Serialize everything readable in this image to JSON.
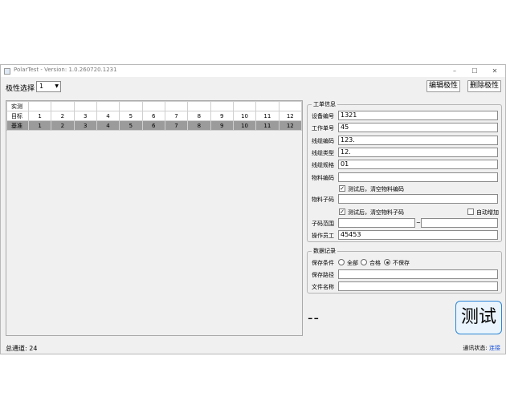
{
  "window": {
    "title": "PolarTest - Version: 1.0.260720.1231",
    "min": "–",
    "max": "☐",
    "close": "✕"
  },
  "toolbar": {
    "polarity_label": "极性选择",
    "polarity_value": "1",
    "edit_button": "编辑极性",
    "delete_button": "删除极性"
  },
  "grid": {
    "rows": [
      {
        "label": "实测",
        "cells": [
          "",
          "",
          "",
          "",
          "",
          "",
          "",
          "",
          "",
          "",
          "",
          ""
        ]
      },
      {
        "label": "目标",
        "cells": [
          "1",
          "2",
          "3",
          "4",
          "5",
          "6",
          "7",
          "8",
          "9",
          "10",
          "11",
          "12"
        ]
      },
      {
        "label": "基准",
        "cells": [
          "1",
          "2",
          "3",
          "4",
          "5",
          "6",
          "7",
          "8",
          "9",
          "10",
          "11",
          "12"
        ]
      }
    ]
  },
  "work_order": {
    "title": "工单信息",
    "device_no_label": "设备编号",
    "device_no": "1321",
    "order_no_label": "工作单号",
    "order_no": "45",
    "cable_code_label": "线缆编码",
    "cable_code": "123.",
    "cable_type_label": "线缆类型",
    "cable_type": "12.",
    "cable_spec_label": "线缆规格",
    "cable_spec": "01",
    "material_code_label": "物料编码",
    "material_code": "",
    "clear_material_label": "测试后，清空物料编码",
    "material_sub_label": "物料子码",
    "material_sub": "",
    "clear_sub_label": "测试后，清空物料子码",
    "auto_increase_label": "自动增加",
    "sub_range_label": "子码范围",
    "range_sep": "~",
    "range_from": "",
    "range_to": "",
    "operator_label": "操作员工",
    "operator": "45453"
  },
  "data_record": {
    "title": "数据记录",
    "save_cond_label": "保存条件",
    "opt_all": "全部",
    "opt_pass": "合格",
    "opt_nosave": "不保存",
    "save_path_label": "保存路径",
    "save_path": "",
    "file_name_label": "文件名称",
    "file_name": ""
  },
  "result": "--",
  "test_button": "测试",
  "status": {
    "channels": "总通道: 24",
    "comm_label": "通讯状态:",
    "comm_state": "连接"
  }
}
